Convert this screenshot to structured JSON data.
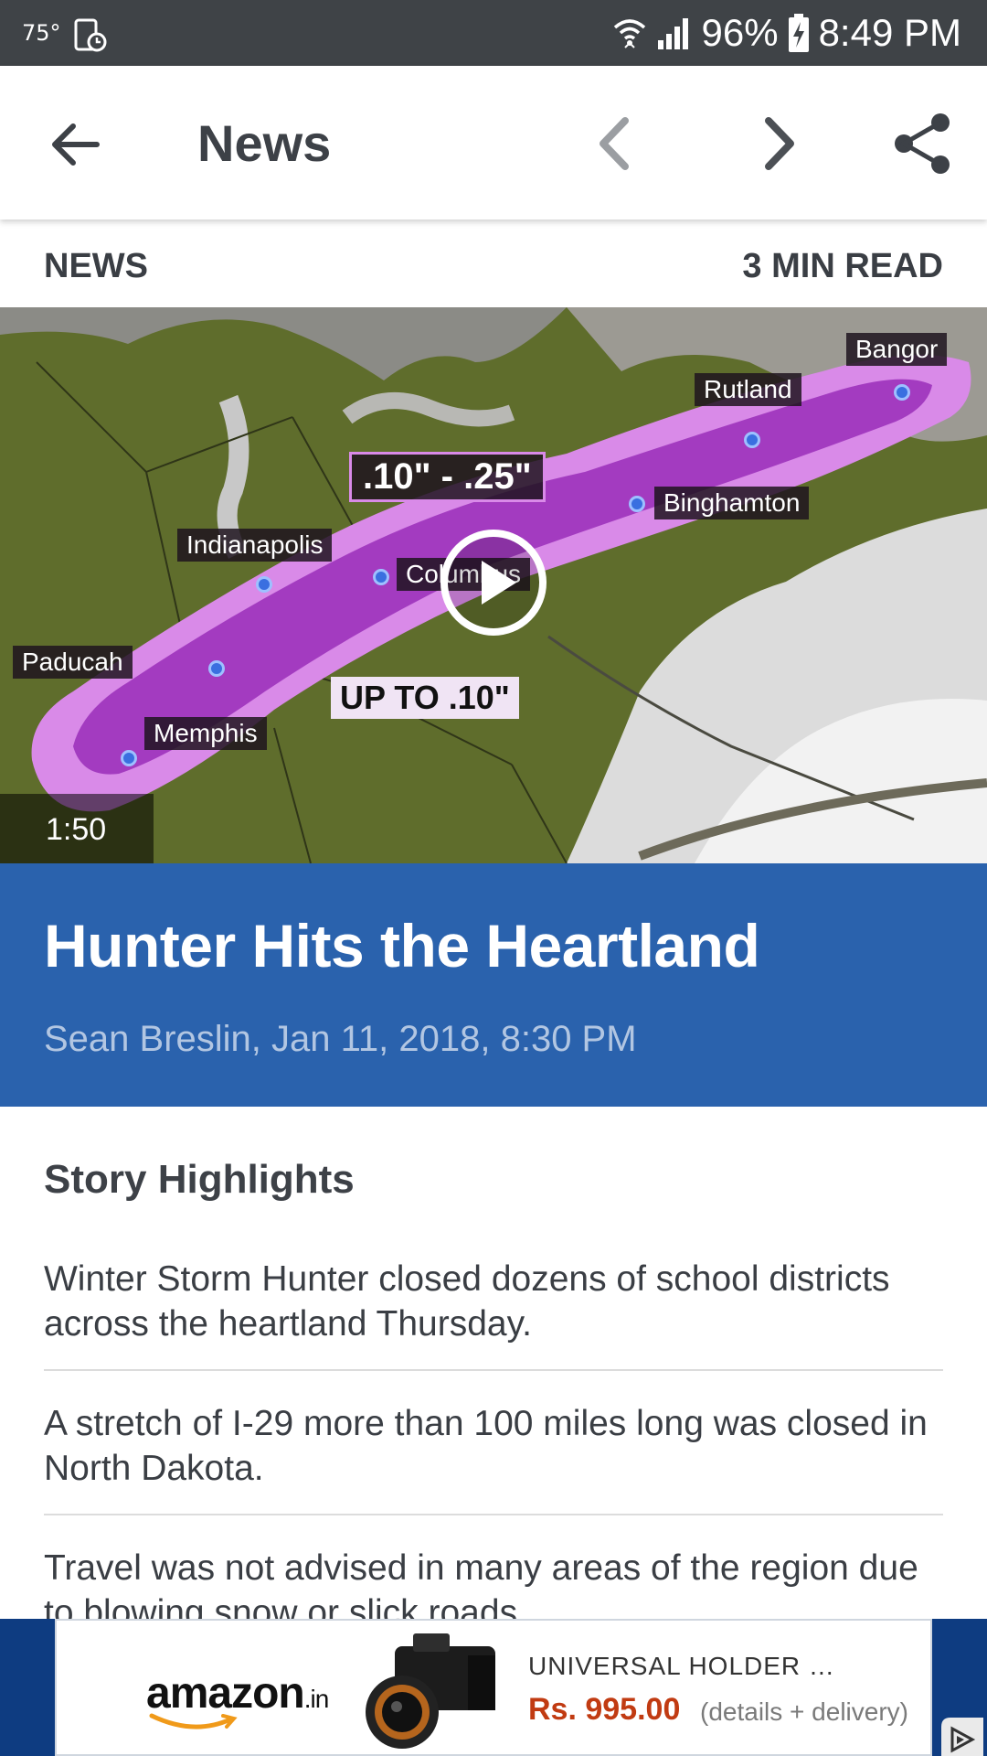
{
  "status_bar": {
    "temperature": "75°",
    "battery": "96%",
    "time": "8:49 PM"
  },
  "app_bar": {
    "title": "News",
    "icons": [
      "back-arrow-icon",
      "chevron-left-icon",
      "chevron-right-icon",
      "share-icon"
    ]
  },
  "article": {
    "category": "NEWS",
    "read_time": "3 MIN READ",
    "video_duration": "1:50",
    "video_overlay": {
      "range_high": ".10\" - .25\"",
      "range_low": "UP TO .10\"",
      "cities": [
        "Bangor",
        "Rutland",
        "Binghamton",
        "Indianapolis",
        "Columbus",
        "Paducah",
        "Memphis"
      ]
    },
    "headline": "Hunter Hits the Heartland",
    "byline": "Sean Breslin, Jan 11, 2018, 8:30 PM"
  },
  "highlights": {
    "title": "Story Highlights",
    "items": [
      "Winter Storm Hunter closed dozens of school districts across the heartland Thursday.",
      "A stretch of I-29 more than 100 miles long was closed in North Dakota.",
      "Travel was not advised in many areas of the region due to blowing snow or slick roads."
    ]
  },
  "ad": {
    "brand": "amazon",
    "brand_suffix": ".in",
    "product_name": "UNIVERSAL HOLDER …",
    "price": "Rs. 995.00",
    "delivery": "(details + delivery)"
  },
  "colors": {
    "status_bar": "#3f4347",
    "headline_background": "#2a62ad",
    "ad_background": "#0e3c81",
    "price": "#c13b12"
  }
}
